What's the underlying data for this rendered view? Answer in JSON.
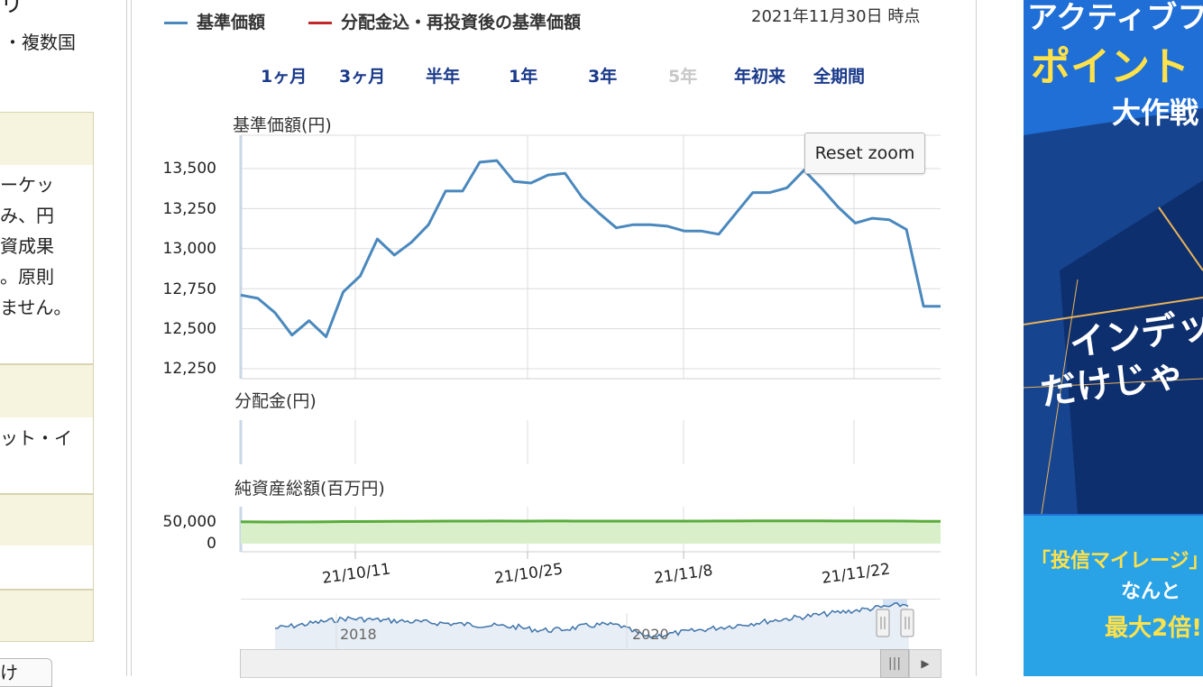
{
  "left": {
    "title_fragment": "リ",
    "subtitle_fragment": "・複数国",
    "para_lines": [
      "ーケッ",
      "み、円",
      "資成果",
      "。原則",
      "ません。"
    ],
    "text2": "ット・イ",
    "bottom_btn": "け"
  },
  "legend": {
    "nav_label": "基準価額",
    "nav_color": "#4a88bd",
    "reinvest_label": "分配金込・再投資後の基準価額",
    "reinvest_color": "#c0282b"
  },
  "as_of": "2021年11月30日 時点",
  "periods": [
    {
      "label": "1ヶ月",
      "enabled": true
    },
    {
      "label": "3ヶ月",
      "enabled": true
    },
    {
      "label": "半年",
      "enabled": true
    },
    {
      "label": "1年",
      "enabled": true
    },
    {
      "label": "3年",
      "enabled": true
    },
    {
      "label": "5年",
      "enabled": false
    },
    {
      "label": "年初来",
      "enabled": true
    },
    {
      "label": "全期間",
      "enabled": true
    }
  ],
  "reset_zoom": "Reset zoom",
  "chart_data": [
    {
      "type": "line",
      "title": "",
      "ylabel": "基準価額(円)",
      "ylim": [
        12250,
        13700
      ],
      "yticks": [
        "13,500",
        "13,250",
        "13,000",
        "12,750",
        "12,500",
        "12,250"
      ],
      "ytick_values": [
        13500,
        13250,
        13000,
        12750,
        12500,
        12250
      ],
      "xticks": [
        "21/10/11",
        "21/10/25",
        "21/11/8",
        "21/11/22"
      ],
      "series": [
        {
          "name": "基準価額",
          "color": "#4a88bd",
          "values": [
            12710,
            12690,
            12600,
            12460,
            12550,
            12450,
            12730,
            12830,
            13060,
            12960,
            13040,
            13150,
            13360,
            13360,
            13540,
            13550,
            13420,
            13410,
            13460,
            13470,
            13320,
            13220,
            13130,
            13150,
            13150,
            13140,
            13110,
            13110,
            13090,
            13220,
            13350,
            13350,
            13380,
            13490,
            13380,
            13260,
            13160,
            13190,
            13180,
            13120,
            12640,
            12640
          ]
        }
      ]
    },
    {
      "type": "bar",
      "ylabel": "分配金(円)",
      "series": []
    },
    {
      "type": "area",
      "ylabel": "純資産総額(百万円)",
      "yticks": [
        "50,000",
        "0"
      ],
      "series": [
        {
          "name": "純資産総額",
          "color": "#5aac3c",
          "fill": "#d8efc9",
          "values": [
            48500,
            48300,
            48100,
            48300,
            48200,
            48600,
            48900,
            49100,
            49300,
            49500,
            49600,
            49800,
            49900,
            50000,
            50100,
            50200,
            50100,
            50100,
            50200,
            50200,
            50100,
            50100,
            50000,
            50000,
            50100,
            50100,
            50100,
            50100,
            50200,
            50300,
            50400,
            50500,
            50600,
            50400,
            50400,
            50300,
            50300,
            50300,
            50300,
            50000,
            49600,
            49600
          ]
        }
      ]
    }
  ],
  "navigator": {
    "years": [
      "2018",
      "2020"
    ]
  },
  "ad": {
    "line1": "アクティブフ",
    "line2": "ポイント",
    "line3": "大作戦",
    "line4": "インデッ",
    "line5": "だけじゃ",
    "line6": "「投信マイレージ」",
    "line7": "なんと",
    "line8": "最大2倍!"
  }
}
